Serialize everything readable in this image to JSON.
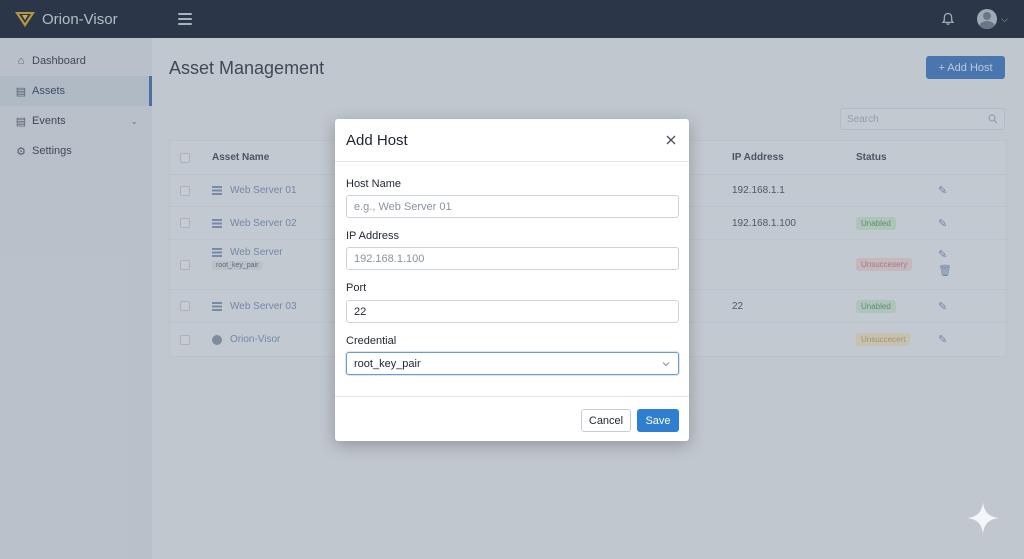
{
  "app": {
    "name": "Orion-Visor"
  },
  "sidebar": {
    "items": [
      {
        "label": "Dashboard",
        "icon": "home-icon"
      },
      {
        "label": "Assets",
        "icon": "server-icon",
        "active": true
      },
      {
        "label": "Events",
        "icon": "events-icon"
      },
      {
        "label": "Settings",
        "icon": "gear-icon"
      }
    ]
  },
  "page": {
    "title": "Asset Management",
    "add_host_label": "+ Add Host",
    "search_placeholder": "Search"
  },
  "table": {
    "columns": [
      "Asset Name",
      "IP Address",
      "Status"
    ],
    "rows": [
      {
        "name": "Web Server 01",
        "ip": "192.168.1.1",
        "status": ""
      },
      {
        "name": "Web Server 02",
        "ip": "192.168.1.100",
        "status": "Unabled"
      },
      {
        "name": "Web Server",
        "tag": "root_key_pair",
        "ip": "",
        "status": "Unsuccesery"
      },
      {
        "name": "Web Server 03",
        "ip": "22",
        "status": "Unabled"
      },
      {
        "name": "Orion-Visor",
        "ip": "",
        "status": "Unsuccecert"
      }
    ]
  },
  "modal": {
    "title": "Add Host",
    "fields": {
      "host_name": {
        "label": "Host Name",
        "placeholder": "e.g., Web Server 01",
        "value": ""
      },
      "ip_address": {
        "label": "IP Address",
        "placeholder": "192.168.1.100",
        "value": ""
      },
      "port": {
        "label": "Port",
        "value": "22"
      },
      "credential": {
        "label": "Credential",
        "value": "root_key_pair"
      }
    },
    "cancel_label": "Cancel",
    "save_label": "Save"
  },
  "colors": {
    "topbar": "#0e1a2b",
    "primary": "#2f7fd0",
    "brand_logo": "#e0a31a"
  }
}
